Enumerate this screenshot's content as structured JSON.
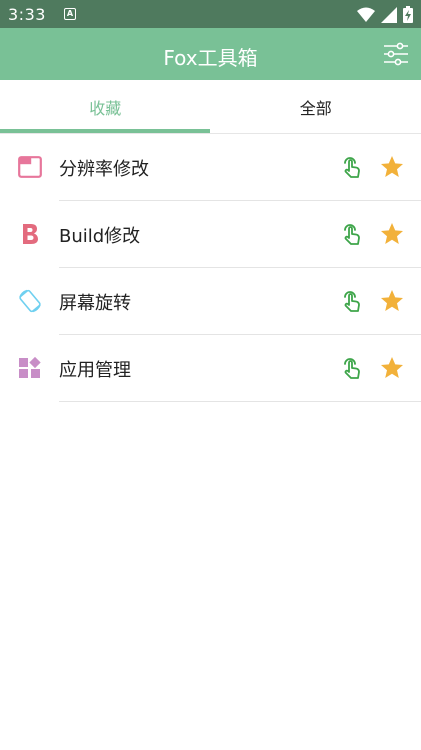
{
  "status_bar": {
    "time": "3:33",
    "notification_icon": "a-app-notification-icon"
  },
  "app_bar": {
    "title": "Fox工具箱",
    "filter_icon": "tune-icon"
  },
  "tabs": [
    {
      "label": "收藏",
      "active": true
    },
    {
      "label": "全部",
      "active": false
    }
  ],
  "items": [
    {
      "label": "分辨率修改",
      "icon": "window-icon",
      "icon_color": "#e7769b"
    },
    {
      "label": "Build修改",
      "icon": "bold-b-icon",
      "icon_color": "#e36b7e"
    },
    {
      "label": "屏幕旋转",
      "icon": "screen-rotation-icon",
      "icon_color": "#6fd0f0"
    },
    {
      "label": "应用管理",
      "icon": "widgets-icon",
      "icon_color": "#c88ec7"
    }
  ],
  "colors": {
    "status_bar": "#4f7a5e",
    "app_bar": "#79c196",
    "accent": "#79c196",
    "touch_icon": "#3ea54a",
    "star": "#f2b13a"
  }
}
